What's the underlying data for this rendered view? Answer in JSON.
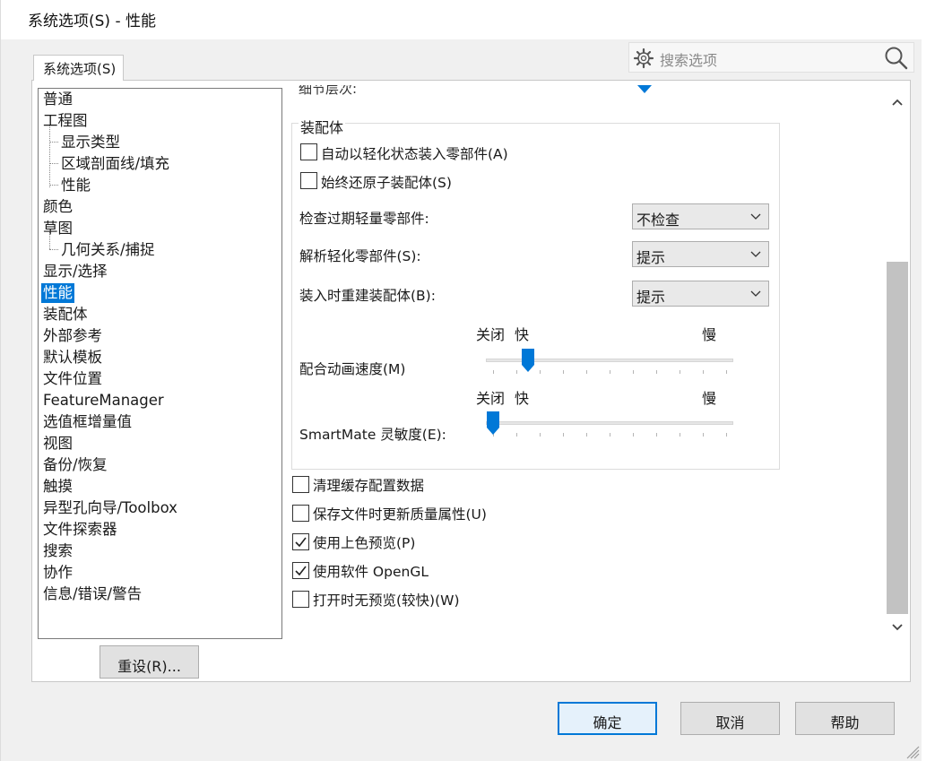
{
  "window": {
    "title": "系统选项(S) - 性能"
  },
  "search": {
    "placeholder": "搜索选项"
  },
  "tab": {
    "label": "系统选项(S)"
  },
  "tree": {
    "items": [
      {
        "label": "普通",
        "level": 0
      },
      {
        "label": "工程图",
        "level": 0
      },
      {
        "label": "显示类型",
        "level": 1
      },
      {
        "label": "区域剖面线/填充",
        "level": 1
      },
      {
        "label": "性能",
        "level": 1
      },
      {
        "label": "颜色",
        "level": 0
      },
      {
        "label": "草图",
        "level": 0
      },
      {
        "label": "几何关系/捕捉",
        "level": 1
      },
      {
        "label": "显示/选择",
        "level": 0
      },
      {
        "label": "性能",
        "level": 0,
        "selected": true
      },
      {
        "label": "装配体",
        "level": 0
      },
      {
        "label": "外部参考",
        "level": 0
      },
      {
        "label": "默认模板",
        "level": 0
      },
      {
        "label": "文件位置",
        "level": 0
      },
      {
        "label": "FeatureManager",
        "level": 0
      },
      {
        "label": "选值框增量值",
        "level": 0
      },
      {
        "label": "视图",
        "level": 0
      },
      {
        "label": "备份/恢复",
        "level": 0
      },
      {
        "label": "触摸",
        "level": 0
      },
      {
        "label": "异型孔向导/Toolbox",
        "level": 0
      },
      {
        "label": "文件探索器",
        "level": 0
      },
      {
        "label": "搜索",
        "level": 0
      },
      {
        "label": "协作",
        "level": 0
      },
      {
        "label": "信息/错误/警告",
        "level": 0
      }
    ]
  },
  "reset_button": "重设(R)...",
  "content": {
    "clipped_label": "细节层次:",
    "group_title": "装配体",
    "checkbox_light": {
      "label": "自动以轻化状态装入零部件(A)",
      "checked": false
    },
    "checkbox_restore": {
      "label": "始终还原子装配体(S)",
      "checked": false
    },
    "check_outdated": {
      "label": "检查过期轻量零部件:",
      "value": "不检查"
    },
    "resolve_light": {
      "label": "解析轻化零部件(S):",
      "value": "提示"
    },
    "rebuild_on_load": {
      "label": "装入时重建装配体(B):",
      "value": "提示"
    },
    "mate_anim": {
      "label": "配合动画速度(M)",
      "off": "关闭",
      "fast": "快",
      "slow": "慢",
      "level": 0.15
    },
    "smartmate": {
      "label": "SmartMate 灵敏度(E):",
      "off": "关闭",
      "fast": "快",
      "slow": "慢",
      "level": 0.0
    },
    "options": [
      {
        "label": "清理缓存配置数据",
        "checked": false
      },
      {
        "label": "保存文件时更新质量属性(U)",
        "checked": false
      },
      {
        "label": "使用上色预览(P)",
        "checked": true
      },
      {
        "label": "使用软件 OpenGL",
        "checked": true
      },
      {
        "label": "打开时无预览(较快)(W)",
        "checked": false
      }
    ]
  },
  "footer": {
    "ok": "确定",
    "cancel": "取消",
    "help": "帮助"
  },
  "colors": {
    "accent": "#0078d7",
    "selection": "#0078d7"
  }
}
